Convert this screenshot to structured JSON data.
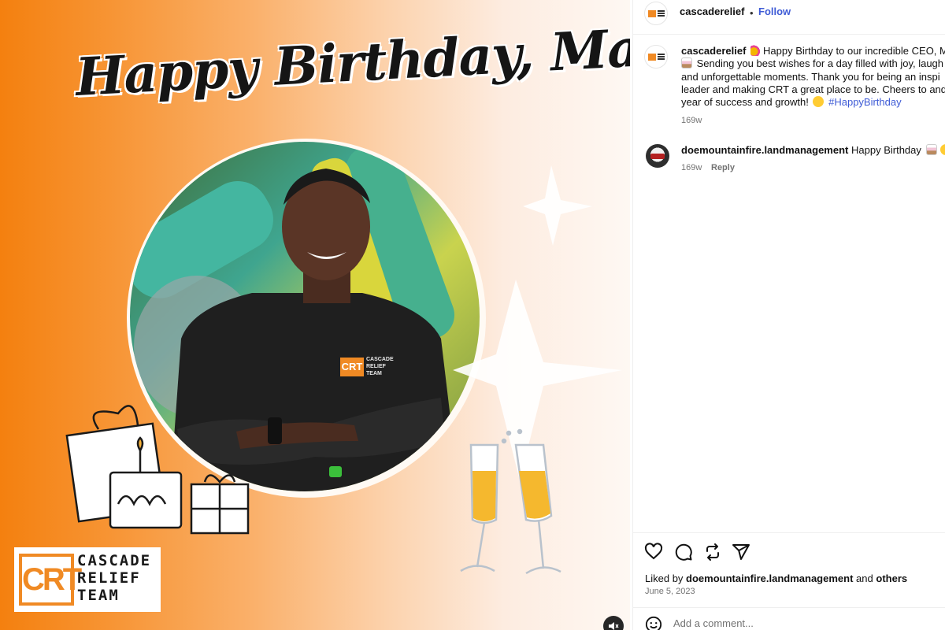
{
  "post_image": {
    "headline": "Happy Birthday, Marc!",
    "shirt_logo": {
      "mark": "CRT",
      "words": [
        "CASCADE",
        "RELIEF",
        "TEAM"
      ]
    },
    "brand_logo": {
      "mark": "CRT",
      "name_lines": [
        "CASCADE",
        "RELIEF",
        "TEAM"
      ]
    },
    "mute_icon": "speaker-muted-icon"
  },
  "header": {
    "username": "cascaderelief",
    "separator": "•",
    "follow_label": "Follow"
  },
  "caption": {
    "username": "cascaderelief",
    "line1": "Happy Birthday to our incredible CEO, M",
    "line2": "Sending you best wishes for a day filled with joy, laugh",
    "line3": "and unforgettable moments. Thank you for being an inspi",
    "line4": "leader and making CRT a great place to be. Cheers to and",
    "line5_text": "year of success and growth!",
    "hashtag": "#HappyBirthday",
    "time": "169w"
  },
  "comments": [
    {
      "username": "doemountainfire.landmanagement",
      "text": "Happy Birthday",
      "time": "169w",
      "reply_label": "Reply"
    }
  ],
  "actions": {
    "icons": [
      "heart-icon",
      "comment-icon",
      "repost-icon",
      "share-icon"
    ],
    "liked_prefix": "Liked by",
    "liked_user": "doemountainfire.landmanagement",
    "liked_and": "and",
    "liked_others": "others",
    "date": "June 5, 2023"
  },
  "add_comment": {
    "placeholder": "Add a comment..."
  },
  "colors": {
    "brand_orange": "#f08a24",
    "link_blue": "#3e5bd6",
    "meta_gray": "#737373"
  }
}
